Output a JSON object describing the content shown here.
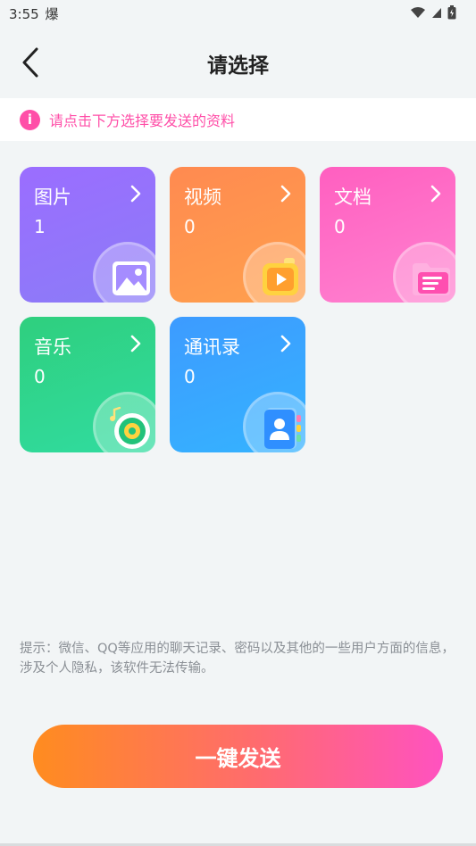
{
  "status": {
    "time": "3:55",
    "alert_glyph": "爆"
  },
  "header": {
    "title": "请选择"
  },
  "notice": {
    "text": "请点击下方选择要发送的资料"
  },
  "categories": [
    {
      "label": "图片",
      "count": "1"
    },
    {
      "label": "视频",
      "count": "0"
    },
    {
      "label": "文档",
      "count": "0"
    },
    {
      "label": "音乐",
      "count": "0"
    },
    {
      "label": "通讯录",
      "count": "0"
    }
  ],
  "tip": "提示：微信、QQ等应用的聊天记录、密码以及其他的一些用户方面的信息，涉及个人隐私，该软件无法传输。",
  "send_button": {
    "label": "一键发送"
  },
  "colors": {
    "accent": "#ff4fa8",
    "photos": "#9b6dff",
    "video": "#ff8a50",
    "docs": "#ff5fc0",
    "music": "#2fcf7e",
    "contacts": "#3d9bff"
  }
}
